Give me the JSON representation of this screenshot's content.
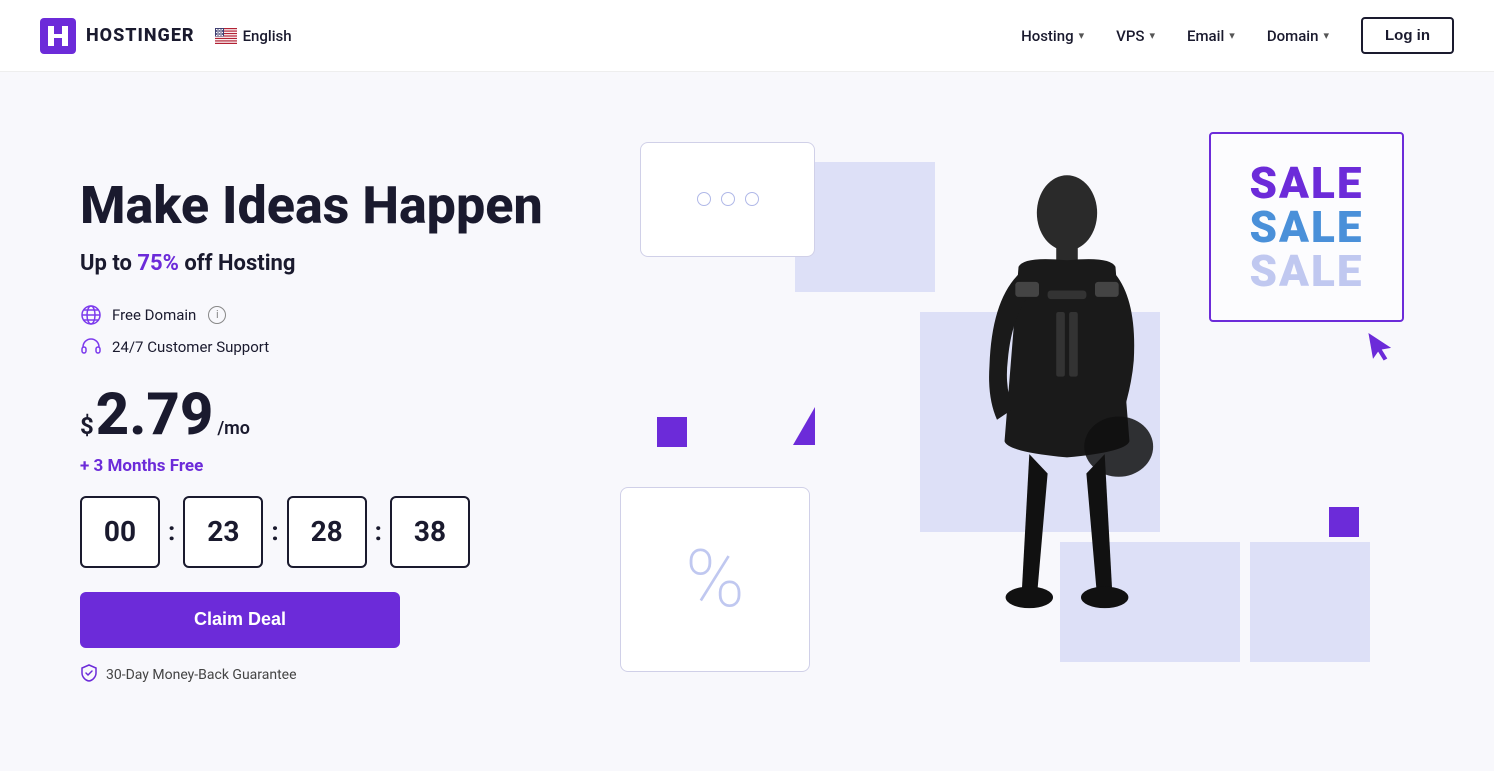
{
  "logo": {
    "text": "HOSTINGER"
  },
  "nav": {
    "lang": "English",
    "items": [
      {
        "label": "Hosting",
        "id": "hosting"
      },
      {
        "label": "VPS",
        "id": "vps"
      },
      {
        "label": "Email",
        "id": "email"
      },
      {
        "label": "Domain",
        "id": "domain"
      }
    ],
    "login_label": "Log in"
  },
  "hero": {
    "headline": "Make Ideas Happen",
    "subheadline_prefix": "Up to ",
    "subheadline_highlight": "75%",
    "subheadline_suffix": " off Hosting",
    "features": [
      {
        "label": "Free Domain",
        "has_info": true
      },
      {
        "label": "24/7 Customer Support",
        "has_info": false
      }
    ],
    "price": {
      "dollar": "$",
      "amount": "2.79",
      "per": "/mo"
    },
    "months_free": "+ 3 Months Free",
    "countdown": {
      "hours": "00",
      "minutes": "23",
      "seconds": "28",
      "milliseconds": "38"
    },
    "cta_label": "Claim Deal",
    "guarantee": "30-Day Money-Back Guarantee"
  },
  "sale_card": {
    "lines": [
      "SALE",
      "SALE",
      "SALE"
    ]
  }
}
